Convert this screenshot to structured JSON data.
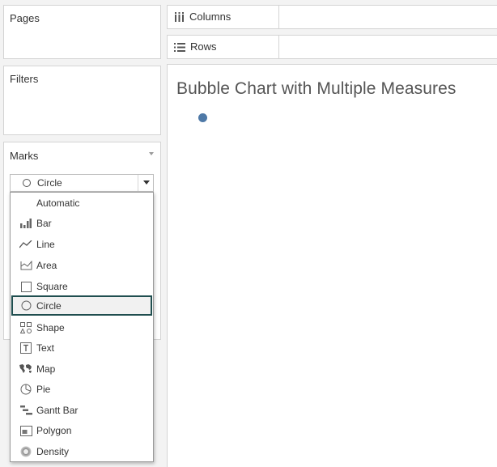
{
  "left_panel": {
    "pages_label": "Pages",
    "filters_label": "Filters",
    "marks_label": "Marks",
    "mark_type_selected": "Circle",
    "mark_type_options": [
      {
        "label": "Automatic",
        "icon": "none"
      },
      {
        "label": "Bar",
        "icon": "bar-icon"
      },
      {
        "label": "Line",
        "icon": "line-icon"
      },
      {
        "label": "Area",
        "icon": "area-icon"
      },
      {
        "label": "Square",
        "icon": "square-icon"
      },
      {
        "label": "Circle",
        "icon": "circle-icon",
        "selected": true
      },
      {
        "label": "Shape",
        "icon": "shape-icon"
      },
      {
        "label": "Text",
        "icon": "text-icon"
      },
      {
        "label": "Map",
        "icon": "map-icon"
      },
      {
        "label": "Pie",
        "icon": "pie-icon"
      },
      {
        "label": "Gantt Bar",
        "icon": "gantt-bar-icon"
      },
      {
        "label": "Polygon",
        "icon": "polygon-icon"
      },
      {
        "label": "Density",
        "icon": "density-icon"
      }
    ]
  },
  "shelves": {
    "columns_label": "Columns",
    "rows_label": "Rows"
  },
  "view": {
    "title": "Bubble Chart with Multiple Measures"
  },
  "colors": {
    "bubble": "#4e79a7",
    "selected_border": "#1f4e4f"
  }
}
